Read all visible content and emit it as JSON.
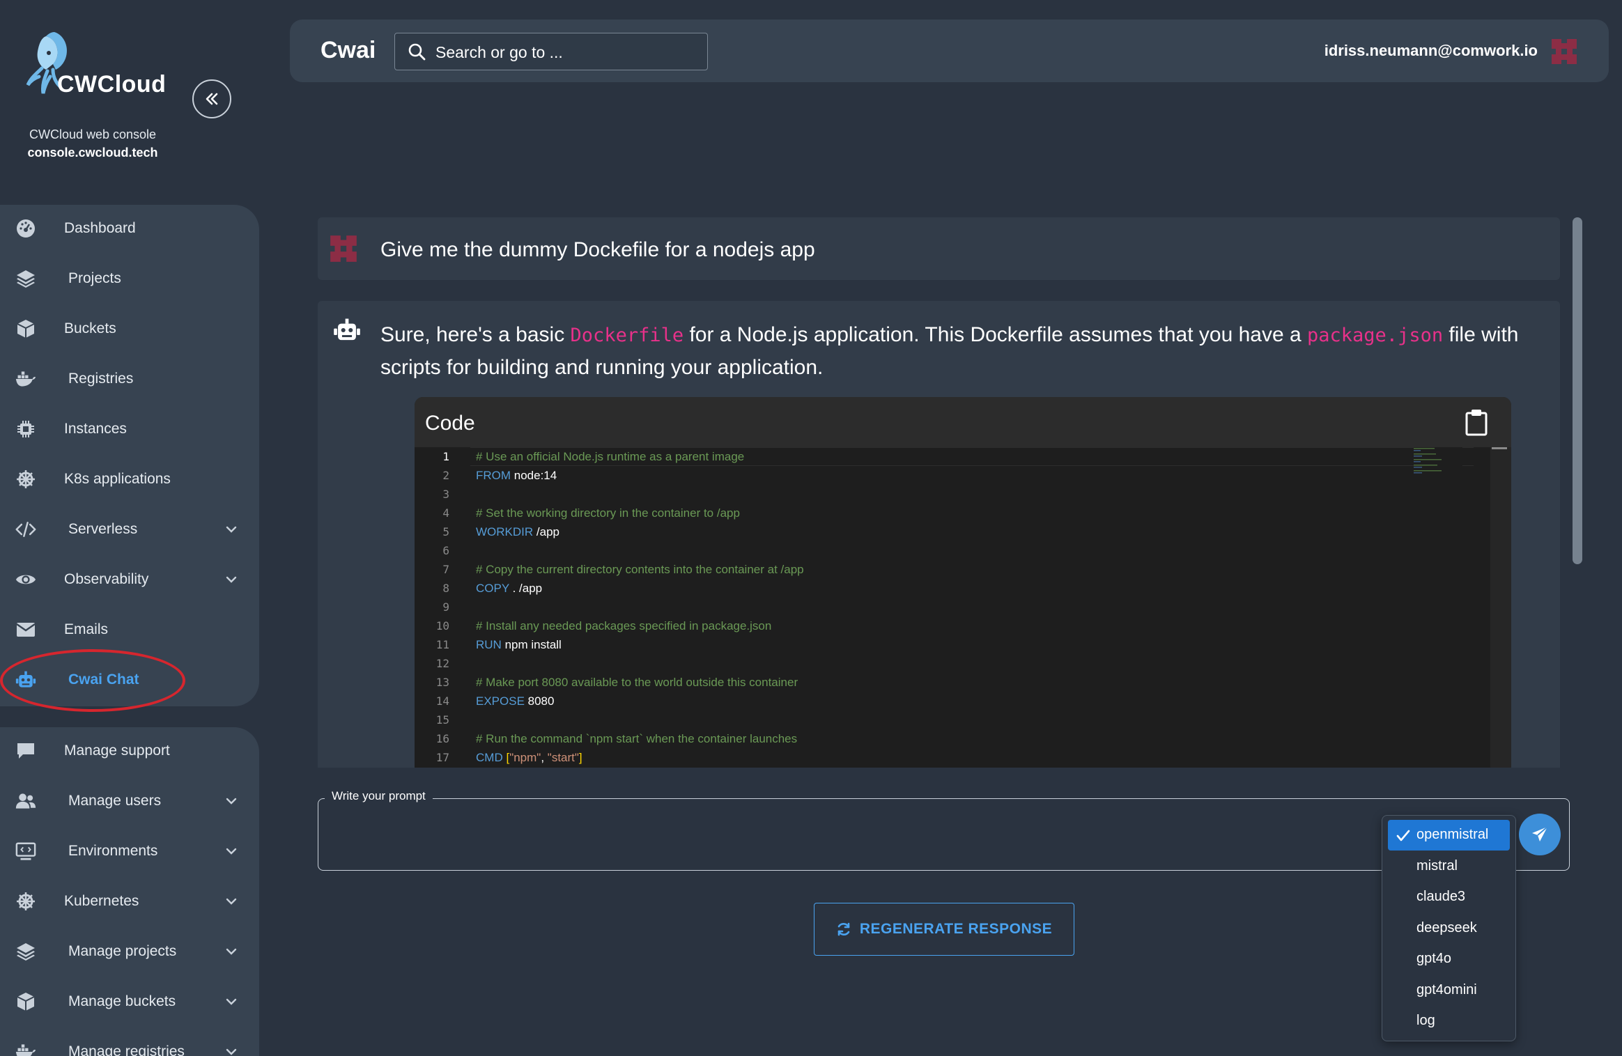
{
  "brand": {
    "logo_text": "CWCloud",
    "console_label": "CWCloud web console",
    "console_url": "console.cwcloud.tech"
  },
  "sidebar": {
    "group1": [
      {
        "label": "Dashboard",
        "icon": "dashboard-icon",
        "expandable": false
      },
      {
        "label": "Projects",
        "icon": "layers-icon",
        "expandable": false
      },
      {
        "label": "Buckets",
        "icon": "cube-icon",
        "expandable": false
      },
      {
        "label": "Registries",
        "icon": "docker-icon",
        "expandable": false
      },
      {
        "label": "Instances",
        "icon": "chip-icon",
        "expandable": false
      },
      {
        "label": "K8s applications",
        "icon": "helm-icon",
        "expandable": false
      },
      {
        "label": "Serverless",
        "icon": "code-icon",
        "expandable": true
      },
      {
        "label": "Observability",
        "icon": "eye-icon",
        "expandable": true
      },
      {
        "label": "Emails",
        "icon": "mail-icon",
        "expandable": false
      },
      {
        "label": "Cwai Chat",
        "icon": "robot-icon",
        "expandable": false,
        "active": true
      }
    ],
    "group2": [
      {
        "label": "Manage support",
        "icon": "chat-bubble-icon",
        "expandable": false
      },
      {
        "label": "Manage users",
        "icon": "users-icon",
        "expandable": true
      },
      {
        "label": "Environments",
        "icon": "monitor-code-icon",
        "expandable": true
      },
      {
        "label": "Kubernetes",
        "icon": "helm-icon",
        "expandable": true
      },
      {
        "label": "Manage projects",
        "icon": "layers-icon",
        "expandable": true
      },
      {
        "label": "Manage buckets",
        "icon": "cube-icon",
        "expandable": true
      },
      {
        "label": "Manage registries",
        "icon": "docker-icon",
        "expandable": true
      }
    ]
  },
  "topbar": {
    "title": "Cwai",
    "search_placeholder": "Search or go to ...",
    "user_email": "idriss.neumann@comwork.io"
  },
  "chat": {
    "user_message": "Give me the dummy Dockefile for a nodejs app",
    "bot_intro_1": "Sure, here's a basic ",
    "bot_code_1": "Dockerfile",
    "bot_intro_2": " for a Node.js application. This Dockerfile assumes that you have a ",
    "bot_code_2": "package.json",
    "bot_intro_3": " file with scripts for building and running your application.",
    "code_title": "Code",
    "code_lines": [
      [
        {
          "t": "# Use an official Node.js runtime as a parent image",
          "k": "comment"
        }
      ],
      [
        {
          "t": "FROM",
          "k": "kw"
        },
        {
          "t": " node:14",
          "k": "plain"
        }
      ],
      [],
      [
        {
          "t": "# Set the working directory in the container to /app",
          "k": "comment"
        }
      ],
      [
        {
          "t": "WORKDIR",
          "k": "kw"
        },
        {
          "t": " /app",
          "k": "plain"
        }
      ],
      [],
      [
        {
          "t": "# Copy the current directory contents into the container at /app",
          "k": "comment"
        }
      ],
      [
        {
          "t": "COPY",
          "k": "kw"
        },
        {
          "t": " . /app",
          "k": "plain"
        }
      ],
      [],
      [
        {
          "t": "# Install any needed packages specified in package.json",
          "k": "comment"
        }
      ],
      [
        {
          "t": "RUN",
          "k": "kw"
        },
        {
          "t": " npm install",
          "k": "plain"
        }
      ],
      [],
      [
        {
          "t": "# Make port 8080 available to the world outside this container",
          "k": "comment"
        }
      ],
      [
        {
          "t": "EXPOSE",
          "k": "kw"
        },
        {
          "t": " 8080",
          "k": "plain"
        }
      ],
      [],
      [
        {
          "t": "# Run the command `npm start` when the container launches",
          "k": "comment"
        }
      ],
      [
        {
          "t": "CMD",
          "k": "kw"
        },
        {
          "t": " ",
          "k": "plain"
        },
        {
          "t": "[",
          "k": "punc"
        },
        {
          "t": "\"npm\"",
          "k": "str"
        },
        {
          "t": ", ",
          "k": "plain"
        },
        {
          "t": "\"start\"",
          "k": "str"
        },
        {
          "t": "]",
          "k": "punc"
        }
      ]
    ]
  },
  "prompt": {
    "legend": "Write your prompt",
    "value": ""
  },
  "models": {
    "options": [
      "openmistral",
      "mistral",
      "claude3",
      "deepseek",
      "gpt4o",
      "gpt4omini",
      "log"
    ],
    "selected": "openmistral"
  },
  "actions": {
    "regenerate_label": "REGENERATE RESPONSE"
  },
  "colors": {
    "background": "#2a3340",
    "panel": "#374351",
    "accent": "#4aa3f0",
    "avatar": "#8c2d45",
    "inline_code": "#e8318a",
    "highlight_ring": "#d6262e"
  }
}
